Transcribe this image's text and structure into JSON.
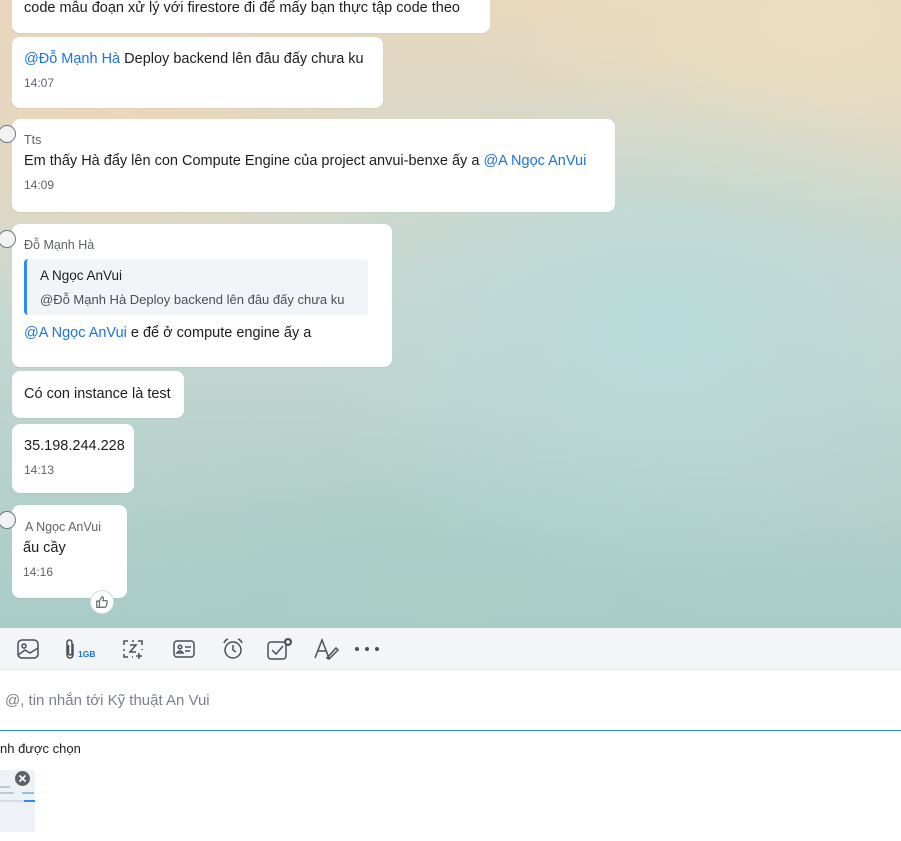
{
  "messages": [
    {
      "text": "code mẫu đoạn xử lý với firestore đi để mấy bạn thực tập code theo"
    },
    {
      "mention": "@Đỗ Mạnh Hà",
      "text": " Deploy backend lên đâu đấy chưa ku",
      "time": "14:07"
    },
    {
      "sender": "Tts",
      "text": "Em thấy Hà đẩy lên con Compute Engine của project anvui-benxe ấy a ",
      "mention": "@A Ngọc AnVui",
      "time": "14:09"
    },
    {
      "sender": "Đỗ Mạnh Hà",
      "quote": {
        "sender": "A Ngọc AnVui",
        "text": "@Đỗ Mạnh Hà Deploy backend lên đâu đấy chưa ku"
      },
      "mention": "@A Ngọc AnVui",
      "text": " e để ở compute engine ấy a"
    },
    {
      "text": "Có con instance là test"
    },
    {
      "text": "35.198.244.228",
      "time": "14:13"
    },
    {
      "sender": "A Ngọc AnVui",
      "text": "ấu cầy",
      "time": "14:16"
    }
  ],
  "toolbar": {
    "attach_size": "1GB",
    "icons": [
      "image-icon",
      "paperclip-icon",
      "screenshot-icon",
      "contact-card-icon",
      "alarm-clock-icon",
      "task-check-icon",
      "text-format-icon",
      "more-icon"
    ]
  },
  "composer": {
    "placeholder": "@, tin nhắn tới Kỹ thuật An Vui"
  },
  "attachments": {
    "label": "nh được chọn"
  },
  "colors": {
    "mention": "#1a73e8",
    "quote_bar": "#2d8cf0",
    "input_focus": "#2d8cf0"
  }
}
